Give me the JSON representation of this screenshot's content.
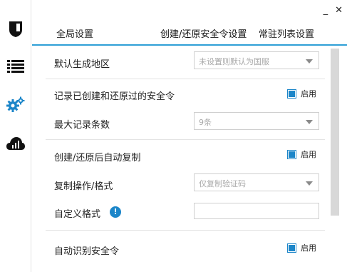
{
  "window": {
    "minimize_glyph": "_",
    "close_glyph": "✕"
  },
  "sidebar": {
    "items": [
      {
        "name": "shield-icon",
        "active": false
      },
      {
        "name": "list-icon",
        "active": false
      },
      {
        "name": "gears-icon",
        "active": true
      },
      {
        "name": "cloud-icon",
        "active": false
      }
    ],
    "active_color": "#1c86c9",
    "icon_color": "#111111"
  },
  "tabs": [
    {
      "label": "全局设置",
      "active": false
    },
    {
      "label": "创建/还原安全令设置",
      "active": true
    },
    {
      "label": "常驻列表设置",
      "active": false
    }
  ],
  "settings": {
    "default_region": {
      "label": "默认生成地区",
      "value": "未设置则默认为国服"
    },
    "record_tokens": {
      "label": "记录已创建和还原过的安全令",
      "checkbox_label": "启用",
      "checked": true
    },
    "max_records": {
      "label": "最大记录条数",
      "value": "9条"
    },
    "auto_copy": {
      "label": "创建/还原后自动复制",
      "checkbox_label": "启用",
      "checked": true
    },
    "copy_format": {
      "label": "复制操作/格式",
      "value": "仅复制验证码"
    },
    "custom_format": {
      "label": "自定义格式",
      "info_glyph": "!",
      "value": ""
    },
    "auto_detect": {
      "label": "自动识别安全令",
      "checkbox_label": "启用",
      "checked": true
    }
  },
  "colors": {
    "accent": "#2f9fd6",
    "checkbox": "#1c86c9"
  }
}
